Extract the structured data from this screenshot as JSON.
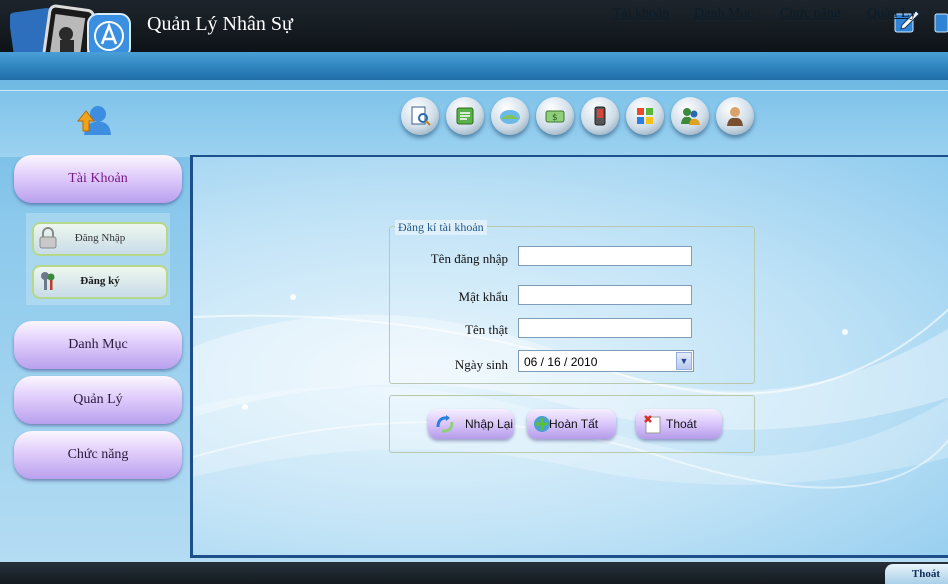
{
  "app": {
    "title": "Quản Lý Nhân Sự"
  },
  "menu": [
    "Tài khoản",
    "Danh Mục",
    "Chức năng",
    "Quản Lý"
  ],
  "toolbar_icons": [
    "search-document-icon",
    "notes-icon",
    "globe-icon",
    "money-icon",
    "phone-icon",
    "windows-icon",
    "users-icon",
    "person-icon"
  ],
  "sidebar": {
    "account": "Tài Khoản",
    "sub_login": "Đăng Nhập",
    "sub_register": "Đăng ký",
    "catalog": "Danh Mục",
    "manage": "Quản Lý",
    "functions": "Chức năng"
  },
  "form": {
    "legend": "Đăng kí tài khoản",
    "username_label": "Tên đăng nhập",
    "username_value": "",
    "password_label": "Mật khẩu",
    "password_value": "",
    "realname_label": "Tên thật",
    "realname_value": "",
    "dob_label": "Ngày sinh",
    "dob_value": "06 / 16 / 2010"
  },
  "actions": {
    "reset": "Nhập Lại",
    "finish": "Hoàn Tất",
    "exit": "Thoát"
  },
  "footer": {
    "exit": "Thoát"
  },
  "colors": {
    "header": "#121a20",
    "menubar": "#2f84be",
    "accent_purple": "#c8b3f5",
    "panel_border": "#1d4f8a"
  }
}
